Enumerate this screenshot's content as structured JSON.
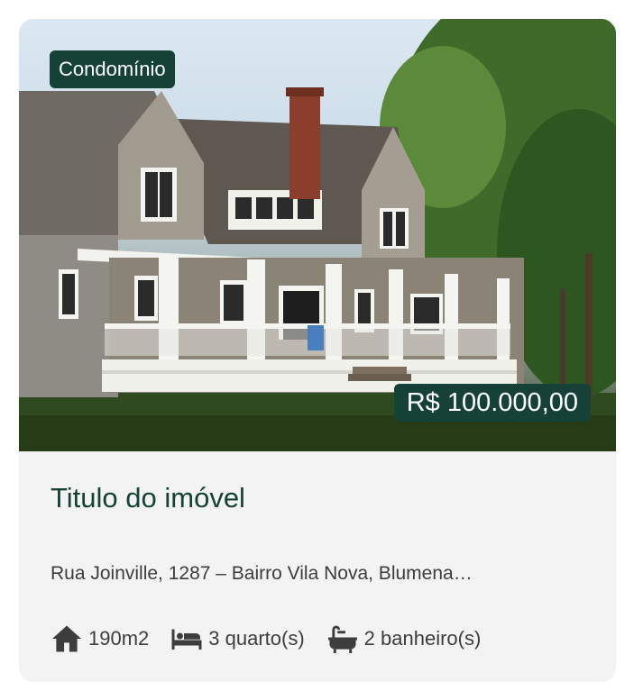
{
  "listing": {
    "type_badge": "Condomínio",
    "price": "R$ 100.000,00",
    "title": "Titulo do imóvel",
    "address": "Rua Joinville, 1287 – Bairro Vila Nova, Blumena…",
    "features": {
      "area": "190m2",
      "bedrooms": "3 quarto(s)",
      "bathrooms": "2 banheiro(s)"
    },
    "photo_description_icons": [
      "home-icon",
      "bed-icon",
      "bathtub-icon"
    ]
  },
  "colors": {
    "accent": "#164136",
    "card_background": "#f3f3f3",
    "body_text": "#3d3d3d"
  }
}
